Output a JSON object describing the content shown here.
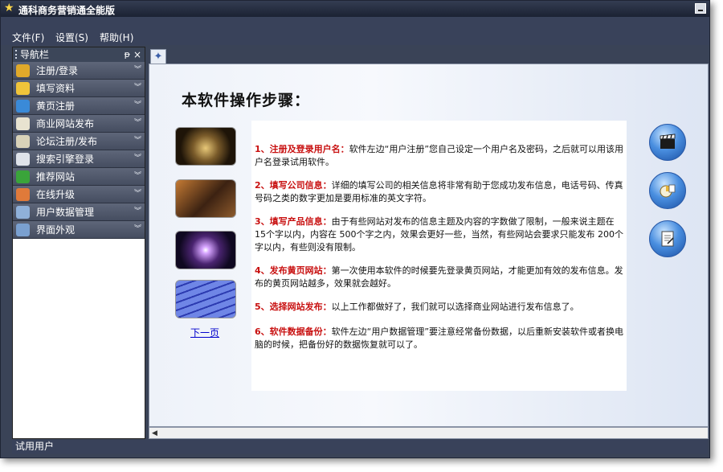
{
  "window": {
    "title": "通科商务营销通全能版"
  },
  "menu": [
    {
      "label": "文件(F)"
    },
    {
      "label": "设置(S)"
    },
    {
      "label": "帮助(H)"
    }
  ],
  "nav": {
    "title": "导航栏",
    "pin_glyph": "ᵽ",
    "close_glyph": "×",
    "items": [
      {
        "label": "注册/登录",
        "icon": "key-icon",
        "color": "#e0a92a"
      },
      {
        "label": "填写资料",
        "icon": "folder-icon",
        "color": "#f0c43a"
      },
      {
        "label": "黄页注册",
        "icon": "globe-icon",
        "color": "#3a8ad8"
      },
      {
        "label": "商业网站发布",
        "icon": "book-icon",
        "color": "#e8e3d0"
      },
      {
        "label": "论坛注册/发布",
        "icon": "notepad-icon",
        "color": "#d9d2b8"
      },
      {
        "label": "搜索引擎登录",
        "icon": "search-engine-icon",
        "color": "#dfe3ea"
      },
      {
        "label": "推荐网站",
        "icon": "thumbs-up-icon",
        "color": "#3aa43a"
      },
      {
        "label": "在线升级",
        "icon": "person-icon",
        "color": "#e07a3a"
      },
      {
        "label": "用户数据管理",
        "icon": "database-icon",
        "color": "#8fb0d9"
      },
      {
        "label": "界面外观",
        "icon": "magnifier-icon",
        "color": "#7aa0d0"
      }
    ]
  },
  "tab": {
    "icon": "star-icon",
    "glyph": "✦"
  },
  "content": {
    "title": "本软件操作步骤：",
    "next_link": "下一页",
    "steps": [
      {
        "head": "1、注册及登录用户名：",
        "text": "软件左边“用户注册”您自己设定一个用户名及密码，之后就可以用该用户名登录试用软件。"
      },
      {
        "head": "2、填写公司信息：",
        "text": "详细的填写公司的相关信息将非常有助于您成功发布信息，电话号码、传真号码之类的数字更加是要用标准的英文字符。"
      },
      {
        "head": "3、填写产品信息：",
        "text": "由于有些网站对发布的信息主题及内容的字数做了限制，一般来说主题在 15个字以内，内容在 500个字之内，效果会更好一些，当然，有些网站会要求只能发布 200个字以内，有些则没有限制。"
      },
      {
        "head": "4、发布黄页网站：",
        "text": "第一次使用本软件的时候要先登录黄页网站，才能更加有效的发布信息。发布的黄页网站越多，效果就会越好。"
      },
      {
        "head": "5、选择网站发布：",
        "text": "以上工作都做好了，我们就可以选择商业网站进行发布信息了。"
      },
      {
        "head": "6、软件数据备份：",
        "text": "软件左边“用户数据管理”要注意经常备份数据，以后重新安装软件或者换电脑的时候，把备份好的数据恢复就可以了。"
      }
    ],
    "thumbnails": [
      "globe-photo",
      "businessman-photo",
      "light-burst-photo",
      "keyboard-photo"
    ],
    "side_buttons": [
      "clapperboard-icon",
      "chart-icon",
      "document-icon"
    ]
  },
  "status": {
    "text": "试用用户"
  }
}
